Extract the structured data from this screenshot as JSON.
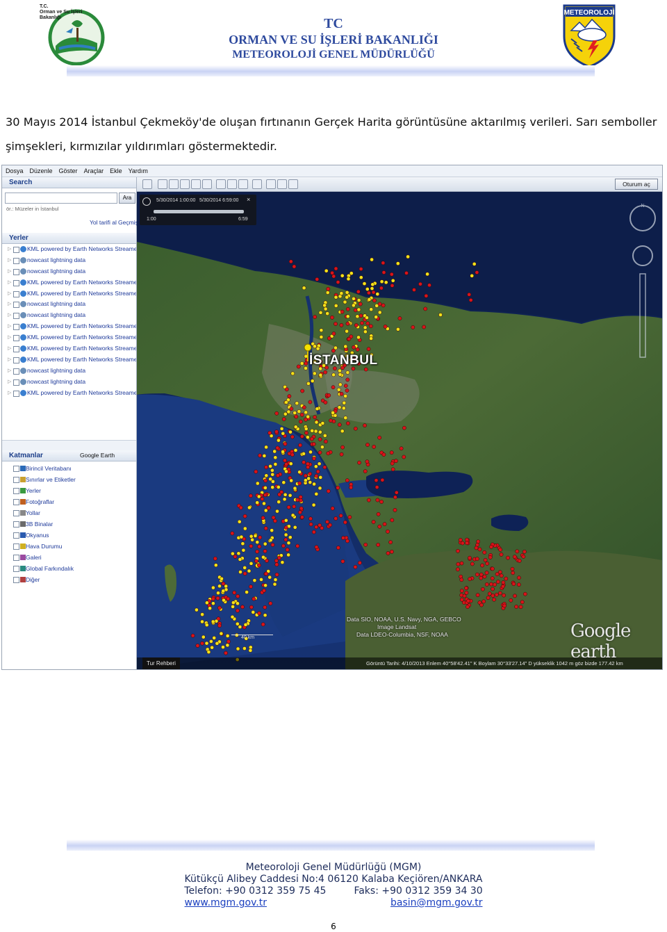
{
  "header": {
    "left_logo_text": [
      "T.C.",
      "Orman ve Su İşleri",
      "Bakanlığı"
    ],
    "line1": "TC",
    "line2": "ORMAN VE SU İŞLERİ BAKANLIĞI",
    "line3": "METEOROLOJİ GENEL MÜDÜRLÜĞÜ",
    "right_logo_text": "METEOROLOJİ",
    "title_color": "#2e4a9e"
  },
  "caption": "30 Mayıs 2014 İstanbul Çekmeköy'de oluşan fırtınanın Gerçek Harita görüntüsüne aktarılmış verileri. Sarı semboller şimşekleri, kırmızılar yıldırımları göstermektedir.",
  "screenshot": {
    "menu": [
      "Dosya",
      "Düzenle",
      "Göster",
      "Araçlar",
      "Ekle",
      "Yardım"
    ],
    "search_title": "Search",
    "search_button": "Ara",
    "search_placeholder": "ör.: Müzeler in İstanbul",
    "directions_link": "Yol tarifi al",
    "history_link": "Geçmiş",
    "places_title": "Yerler",
    "places_items": [
      "KML powered by Earth Networks Streamer...",
      "nowcast lightning data",
      "nowcast lightning data",
      "KML powered by Earth Networks Streamer...",
      "KML powered by Earth Networks Streamer...",
      "nowcast lightning data",
      "nowcast lightning data",
      "KML powered by Earth Networks Streamer...",
      "KML powered by Earth Networks Streamer...",
      "KML powered by Earth Networks Streamer...",
      "KML powered by Earth Networks Streamer...",
      "nowcast lightning data",
      "nowcast lightning data",
      "KML powered by Earth Networks Streamer..."
    ],
    "layers_title": "Katmanlar",
    "gallery_button": "Google Earth Galerisi",
    "layers_items": [
      "Birincil Veritabanı",
      "Sınırlar ve Etiketler",
      "Yerler",
      "Fotoğraflar",
      "Yollar",
      "3B Binalar",
      "Okyanus",
      "Hava Durumu",
      "Galeri",
      "Global Farkındalık",
      "Diğer"
    ],
    "signout_button": "Oturum aç",
    "time_start": "5/30/2014  1:00:00",
    "time_end": "5/30/2014  6:59:00",
    "time_range_left": "1:00",
    "time_range_right": "6:59",
    "map_label": "İSTANBUL",
    "attribution": [
      "Data SIO, NOAA, U.S. Navy, NGA, GEBCO",
      "Image Landsat",
      "Data LDEO-Columbia, NSF, NOAA"
    ],
    "brand": "Google earth",
    "scale": "40 km",
    "tour_guide": "Tur Rehberi",
    "status_text": "Görüntü Tarihi: 4/10/2013    Enlem   40°58'42.41\" K   Boylam   30°33'27.14\" D   yükseklik   1042 m     göz bizde   177.42 km",
    "lightning_color_yellow": "#f2e21a",
    "lightning_color_red": "#d8141a"
  },
  "footer": {
    "line1": "Meteoroloji Genel Müdürlüğü (MGM)",
    "line2": "Kütükçü Alibey Caddesi No:4 06120 Kalaba Keçiören/ANKARA",
    "phone": "Telefon: +90 0312 359 75 45",
    "fax": "Faks: +90 0312 359 34 30",
    "web": "www.mgm.gov.tr",
    "email": "basin@mgm.gov.tr"
  },
  "page_number": "6"
}
